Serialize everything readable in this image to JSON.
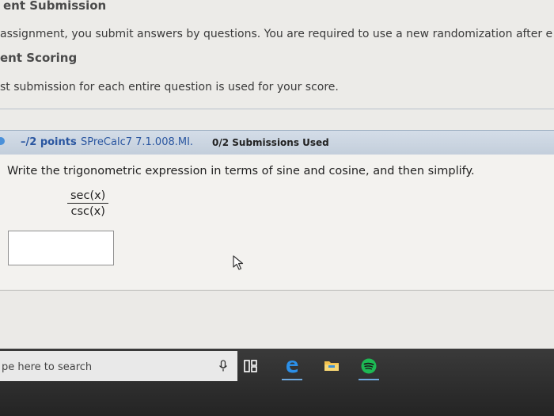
{
  "header": {
    "section_title": "ent Submission",
    "assignment_line": "assignment, you submit answers by questions. You are required to use a new randomization after e",
    "scoring_title": "ent Scoring",
    "scoring_line": "st submission for each entire question is used for your score."
  },
  "question": {
    "points": "–/2 points",
    "code": "SPreCalc7 7.1.008.MI.",
    "submissions": "0/2 Submissions Used",
    "prompt": "Write the trigonometric expression in terms of sine and cosine, and then simplify.",
    "numerator": "sec(x)",
    "denominator": "csc(x)",
    "answer_value": ""
  },
  "taskbar": {
    "search_placeholder": "pe here to search",
    "icons": [
      "microphone-icon",
      "task-view-icon",
      "edge-icon",
      "file-explorer-icon",
      "spotify-icon"
    ]
  },
  "colors": {
    "question_bar": "#c8d3df",
    "points_text": "#2a56a0",
    "spotify": "#1db954",
    "edge": "#1e90ff",
    "explorer": "#f2c14e"
  }
}
